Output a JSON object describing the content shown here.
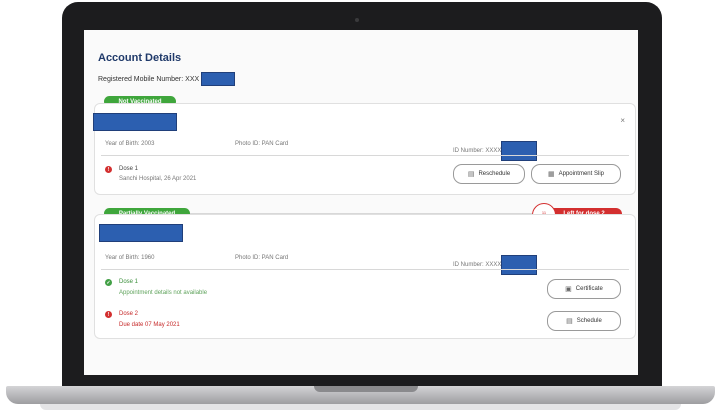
{
  "account": {
    "title": "Account Details",
    "mobile_label": "Registered Mobile Number: XXX"
  },
  "beneficiary_1": {
    "status_badge": "Not Vaccinated",
    "close_icon": "×",
    "year_of_birth": "Year of Birth: 2003",
    "photo_id": "Photo ID: PAN Card",
    "id_number": "ID Number: XXXX",
    "dose1": {
      "title": "Dose 1",
      "detail": "Sanchi Hospital, 26 Apr 2021",
      "status_icon": "!"
    },
    "reschedule_label": "Reschedule",
    "appointment_slip_label": "Appointment Slip"
  },
  "beneficiary_2": {
    "status_badge": "Partially Vaccinated",
    "days_count": "11",
    "days_word": "Days",
    "left_for_dose2": "Left for dose 2",
    "year_of_birth": "Year of Birth: 1960",
    "photo_id": "Photo ID: PAN Card",
    "id_number": "ID Number: XXXX",
    "dose1": {
      "title": "Dose 1",
      "detail": "Appointment details not available",
      "status_icon": "✓"
    },
    "dose2": {
      "title": "Dose 2",
      "detail": "Due date 07 May 2021",
      "status_icon": "!"
    },
    "certificate_label": "Certificate",
    "schedule_label": "Schedule"
  },
  "colors": {
    "title_blue": "#203a6a",
    "green": "#3fa63c",
    "red": "#d32f2f",
    "redaction_blue": "#2c5fb0"
  }
}
